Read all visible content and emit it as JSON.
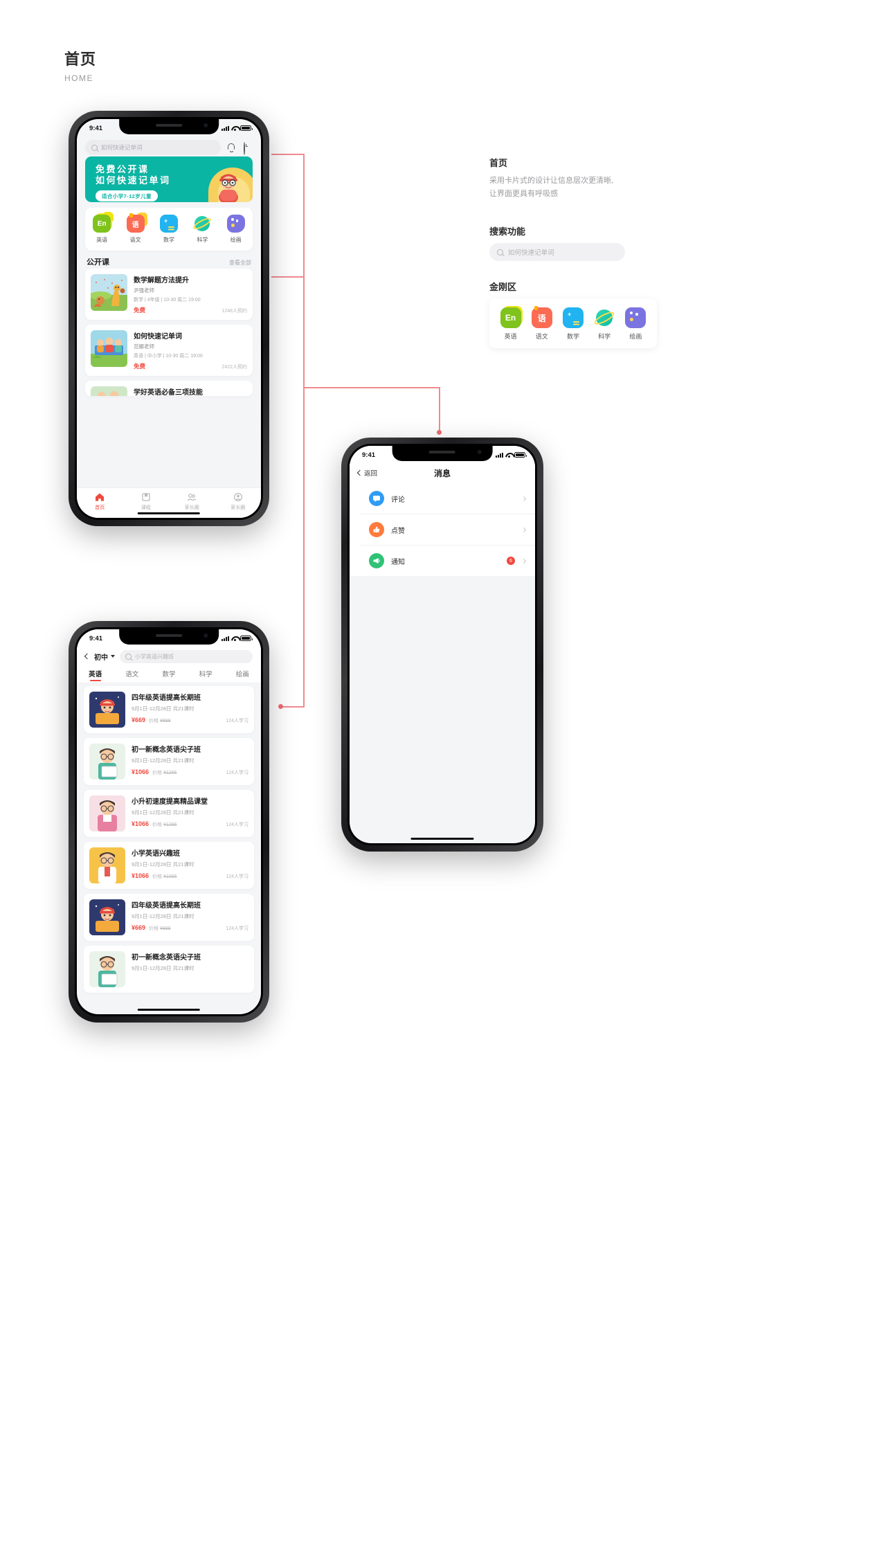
{
  "page": {
    "title_zh": "首页",
    "title_en": "HOME"
  },
  "status_bar": {
    "time": "9:41"
  },
  "home": {
    "search_placeholder": "如何快速记单词",
    "banner": {
      "line1": "免费公开课",
      "line2": "如何快速记单词",
      "tag": "适合小学7-12岁儿童"
    },
    "categories": [
      {
        "label": "英语",
        "icon": "en-icon",
        "color": "#7fc31c"
      },
      {
        "label": "语文",
        "icon": "chinese-icon",
        "color": "#fb6a53"
      },
      {
        "label": "数学",
        "icon": "math-icon",
        "color": "#22b3f1"
      },
      {
        "label": "科学",
        "icon": "science-icon",
        "color": "#0fbfa0"
      },
      {
        "label": "绘画",
        "icon": "painting-icon",
        "color": "#7b74e0"
      }
    ],
    "section": {
      "title": "公开课",
      "more": "查看全部"
    },
    "courses": [
      {
        "title": "数学解题方法提升",
        "teacher": "尹强老师",
        "meta": "数学 | 4年级 | 10-30 周二 19:00",
        "price": "免费",
        "count": "1248人预约"
      },
      {
        "title": "如何快速记单词",
        "teacher": "范娜老师",
        "meta": "英语 | 中小学 | 10-30 周二 19:00",
        "price": "免费",
        "count": "2422人预约"
      },
      {
        "title": "学好英语必备三项技能",
        "teacher": "",
        "meta": "",
        "price": "",
        "count": ""
      }
    ],
    "tabs": [
      {
        "label": "首页",
        "icon": "home-icon",
        "active": true
      },
      {
        "label": "课程",
        "icon": "course-icon",
        "active": false
      },
      {
        "label": "家长圈",
        "icon": "parents-icon",
        "active": false
      },
      {
        "label": "家长圈",
        "icon": "profile-icon",
        "active": false
      }
    ]
  },
  "messages": {
    "back_label": "返回",
    "title": "消息",
    "rows": [
      {
        "label": "评论",
        "icon": "comment-icon",
        "color": "#2f9cf4",
        "badge": ""
      },
      {
        "label": "点赞",
        "icon": "like-icon",
        "color": "#ff7a3c",
        "badge": ""
      },
      {
        "label": "通知",
        "icon": "notice-icon",
        "color": "#2fc277",
        "badge": "6"
      }
    ]
  },
  "course_list": {
    "grade": "初中",
    "search_placeholder": "小学英语兴趣班",
    "tabs": [
      {
        "label": "英语",
        "active": true
      },
      {
        "label": "语文",
        "active": false
      },
      {
        "label": "数学",
        "active": false
      },
      {
        "label": "科学",
        "active": false
      },
      {
        "label": "绘画",
        "active": false
      }
    ],
    "items": [
      {
        "title": "四年级英语提高长期班",
        "date": "9月1日-12月28日   共21课时",
        "price": "¥669",
        "old_label": "价格",
        "old_price": "¥888",
        "count": "124人学习",
        "thumb": "boy-book"
      },
      {
        "title": "初一新概念英语尖子班",
        "date": "9月1日-12月28日   共21课时",
        "price": "¥1066",
        "old_label": "价格",
        "old_price": "¥1266",
        "count": "124人学习",
        "thumb": "boy-paper"
      },
      {
        "title": "小升初速度提高精品课堂",
        "date": "9月1日-12月28日   共21课时",
        "price": "¥1066",
        "old_label": "价格",
        "old_price": "¥1266",
        "count": "124人学习",
        "thumb": "boy-pink"
      },
      {
        "title": "小学英语兴趣班",
        "date": "9月1日-12月28日   共21课时",
        "price": "¥1066",
        "old_label": "价格",
        "old_price": "¥1066",
        "count": "124人学习",
        "thumb": "boy-orange"
      },
      {
        "title": "四年级英语提高长期班",
        "date": "9月1日-12月28日   共21课时",
        "price": "¥669",
        "old_label": "价格",
        "old_price": "¥888",
        "count": "124人学习",
        "thumb": "boy-book"
      },
      {
        "title": "初一新概念英语尖子班",
        "date": "9月1日-12月28日   共21课时",
        "price": "",
        "old_label": "",
        "old_price": "",
        "count": "",
        "thumb": "boy-paper"
      }
    ]
  },
  "annotations": {
    "home": {
      "heading": "首页",
      "body_line1": "采用卡片式的设计让信息层次更清晰,",
      "body_line2": "让界面更具有呼吸感"
    },
    "search": {
      "heading": "搜索功能",
      "placeholder": "如何快速记单词"
    },
    "kingkong": {
      "heading": "金刚区",
      "categories": [
        {
          "label": "英语"
        },
        {
          "label": "语文"
        },
        {
          "label": "数学"
        },
        {
          "label": "科学"
        },
        {
          "label": "绘画"
        }
      ]
    }
  },
  "theme": {
    "accent_red": "#f0493e",
    "banner_green": "#0bb5a4",
    "line_pink": "#f08a8f"
  }
}
